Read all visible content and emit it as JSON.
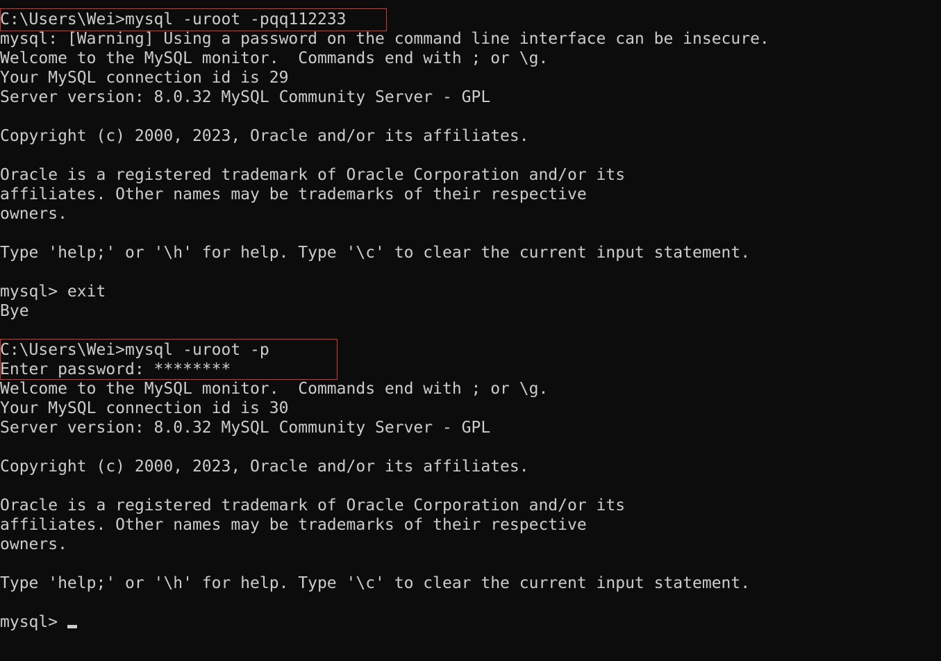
{
  "terminal": {
    "lines": [
      "C:\\Users\\Wei>mysql -uroot -pqq112233",
      "mysql: [Warning] Using a password on the command line interface can be insecure.",
      "Welcome to the MySQL monitor.  Commands end with ; or \\g.",
      "Your MySQL connection id is 29",
      "Server version: 8.0.32 MySQL Community Server - GPL",
      "",
      "Copyright (c) 2000, 2023, Oracle and/or its affiliates.",
      "",
      "Oracle is a registered trademark of Oracle Corporation and/or its",
      "affiliates. Other names may be trademarks of their respective",
      "owners.",
      "",
      "Type 'help;' or '\\h' for help. Type '\\c' to clear the current input statement.",
      "",
      "mysql> exit",
      "Bye",
      "",
      "C:\\Users\\Wei>mysql -uroot -p",
      "Enter password: ********",
      "Welcome to the MySQL monitor.  Commands end with ; or \\g.",
      "Your MySQL connection id is 30",
      "Server version: 8.0.32 MySQL Community Server - GPL",
      "",
      "Copyright (c) 2000, 2023, Oracle and/or its affiliates.",
      "",
      "Oracle is a registered trademark of Oracle Corporation and/or its",
      "affiliates. Other names may be trademarks of their respective",
      "owners.",
      "",
      "Type 'help;' or '\\h' for help. Type '\\c' to clear the current input statement.",
      "",
      "mysql> "
    ]
  },
  "colors": {
    "background": "#0c0c0c",
    "foreground": "#cccccc",
    "highlight_border": "#e0302a"
  }
}
